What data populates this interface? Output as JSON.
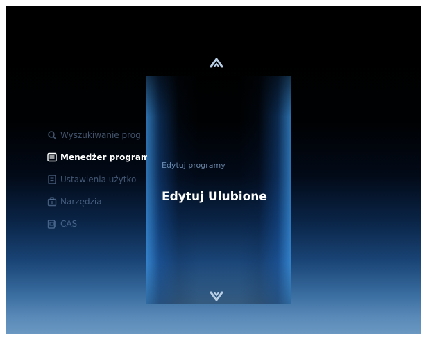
{
  "left_menu": {
    "items": [
      {
        "label": "Wyszukiwanie prog",
        "icon": "search-icon",
        "active": false
      },
      {
        "label": "Menedżer program",
        "icon": "program-manager-icon",
        "active": true
      },
      {
        "label": "Ustawienia użytko",
        "icon": "user-settings-icon",
        "active": false
      },
      {
        "label": "Narzędzia",
        "icon": "tools-icon",
        "active": false
      },
      {
        "label": "CAS",
        "icon": "cas-card-icon",
        "active": false
      }
    ]
  },
  "submenu": {
    "items": [
      {
        "label": "Edytuj programy",
        "selected": false
      },
      {
        "label": "Edytuj Ulubione",
        "selected": true
      }
    ]
  },
  "colors": {
    "highlight_blue": "#3c96e6",
    "text_active": "#ffffff",
    "text_dim": "#7896be"
  }
}
